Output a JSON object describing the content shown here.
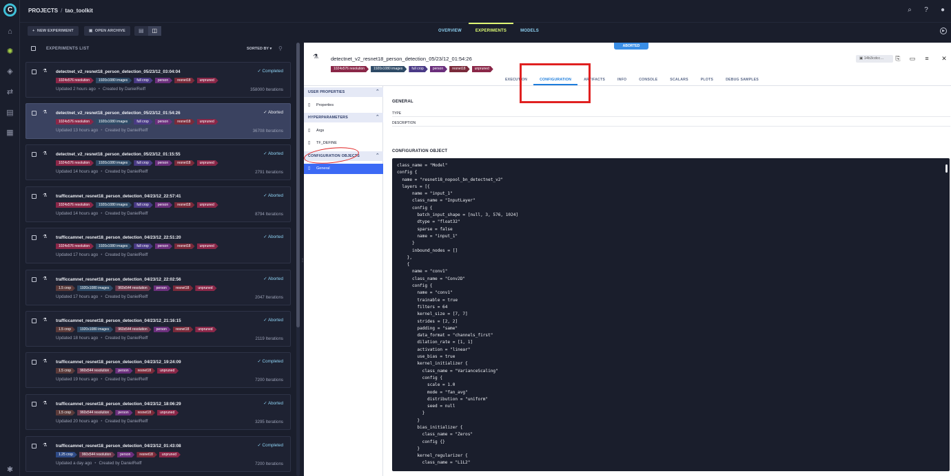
{
  "breadcrumb": {
    "projects": "PROJECTS",
    "separator": "/",
    "project": "tao_toolkit"
  },
  "toolbar": {
    "new_experiment": "NEW EXPERIMENT",
    "open_archive": "OPEN ARCHIVE"
  },
  "main_tabs": [
    {
      "label": "OVERVIEW"
    },
    {
      "label": "EXPERIMENTS"
    },
    {
      "label": "MODELS"
    }
  ],
  "list": {
    "title": "EXPERIMENTS LIST",
    "sorted_by": "SORTED BY ▾",
    "items": [
      {
        "name": "detectnet_v2_resnet18_person_detection_05/23/12_03:04:04",
        "status": "✓ Completed",
        "tags": [
          "1024x576 resolution",
          "1920x1080 images",
          "full crop",
          "person",
          "resnet18",
          "unpruned"
        ],
        "updated": "Updated 2 hours ago",
        "creator": "Created by DanielReiff",
        "iterations": "358000 Iterations"
      },
      {
        "name": "detectnet_v2_resnet18_person_detection_05/23/12_01:54:26",
        "status": "✓ Aborted",
        "tags": [
          "1024x576 resolution",
          "1920x1080 images",
          "full crop",
          "person",
          "resnet18",
          "unpruned"
        ],
        "updated": "Updated 13 hours ago",
        "creator": "Created by DanielReiff",
        "iterations": "36708 Iterations"
      },
      {
        "name": "detectnet_v2_resnet18_person_detection_05/23/12_01:15:55",
        "status": "✓ Aborted",
        "tags": [
          "1024x576 resolution",
          "1920x1080 images",
          "full crop",
          "person",
          "resnet18",
          "unpruned"
        ],
        "updated": "Updated 14 hours ago",
        "creator": "Created by DanielReiff",
        "iterations": "2791 Iterations"
      },
      {
        "name": "trafficcamnet_resnet18_person_detection_04/23/12_22:57:41",
        "status": "✓ Aborted",
        "tags": [
          "1024x576 resolution",
          "1920x1080 images",
          "full crop",
          "person",
          "resnet18",
          "unpruned"
        ],
        "updated": "Updated 14 hours ago",
        "creator": "Created by DanielReiff",
        "iterations": "8794 Iterations"
      },
      {
        "name": "trafficcamnet_resnet18_person_detection_04/23/12_22:51:20",
        "status": "✓ Aborted",
        "tags": [
          "1024x576 resolution",
          "1920x1080 images",
          "full crop",
          "person",
          "resnet18",
          "unpruned"
        ],
        "updated": "Updated 17 hours ago",
        "creator": "Created by DanielReiff",
        "iterations": ""
      },
      {
        "name": "trafficcamnet_resnet18_person_detection_04/23/12_22:02:56",
        "status": "✓ Aborted",
        "tags": [
          "1.5 crop",
          "1920x1080 images",
          "960x544 resolution",
          "person",
          "resnet18",
          "unpruned"
        ],
        "updated": "Updated 17 hours ago",
        "creator": "Created by DanielReiff",
        "iterations": "2047 Iterations"
      },
      {
        "name": "trafficcamnet_resnet18_person_detection_04/23/12_21:16:15",
        "status": "✓ Aborted",
        "tags": [
          "1.5 crop",
          "1920x1080 images",
          "960x544 resolution",
          "person",
          "resnet18",
          "unpruned"
        ],
        "updated": "Updated 18 hours ago",
        "creator": "Created by DanielReiff",
        "iterations": "2119 Iterations"
      },
      {
        "name": "trafficcamnet_resnet18_person_detection_04/23/12_19:24:09",
        "status": "✓ Completed",
        "tags": [
          "1.5 crop",
          "960x544 resolution",
          "person",
          "resnet18",
          "unpruned"
        ],
        "updated": "Updated 19 hours ago",
        "creator": "Created by DanielReiff",
        "iterations": "7200 Iterations"
      },
      {
        "name": "trafficcamnet_resnet18_person_detection_04/23/12_18:06:29",
        "status": "✓ Aborted",
        "tags": [
          "1.5 crop",
          "960x544 resolution",
          "person",
          "resnet18",
          "unpruned"
        ],
        "updated": "Updated 20 hours ago",
        "creator": "Created by DanielReiff",
        "iterations": "3295 Iterations"
      },
      {
        "name": "trafficcamnet_resnet18_person_detection_04/23/12_01:43:08",
        "status": "✓ Completed",
        "tags": [
          "1.25 crop",
          "960x544 resolution",
          "person",
          "resnet18",
          "unpruned"
        ],
        "updated": "Updated a day ago",
        "creator": "Created by DanielReiff",
        "iterations": "7200 Iterations"
      }
    ]
  },
  "detail": {
    "ribbon": "ABORTED",
    "title": "detectnet_v2_resnet18_person_detection_05/23/12_01:54:26",
    "tags": [
      "1024x576 resolution",
      "1920x1080 images",
      "full crop",
      "person",
      "resnet18",
      "unpruned"
    ],
    "id": "14b3cdcc…",
    "tabs": [
      {
        "label": "EXECUTION"
      },
      {
        "label": "CONFIGURATION"
      },
      {
        "label": "ARTIFACTS"
      },
      {
        "label": "INFO"
      },
      {
        "label": "CONSOLE"
      },
      {
        "label": "SCALARS"
      },
      {
        "label": "PLOTS"
      },
      {
        "label": "DEBUG SAMPLES"
      }
    ],
    "nav": {
      "user_properties": "USER PROPERTIES",
      "properties": "Properties",
      "hyperparameters": "HYPERPARAMETERS",
      "args": "Args",
      "tf_define": "TF_DEFINE",
      "config_objects": "CONFIGURATION OBJECTS",
      "general": "General"
    },
    "general_title": "GENERAL",
    "type_label": "TYPE",
    "description_label": "DESCRIPTION",
    "config_object_title": "CONFIGURATION OBJECT",
    "code": "class_name = \"Model\"\nconfig {\n  name = \"resnet18_nopool_bn_detectnet_v2\"\n  layers = [{\n      name = \"input_1\"\n      class_name = \"InputLayer\"\n      config {\n        batch_input_shape = [null, 3, 576, 1024]\n        dtype = \"float32\"\n        sparse = false\n        name = \"input_1\"\n      }\n      inbound_nodes = []\n    },\n    {\n      name = \"conv1\"\n      class_name = \"Conv2D\"\n      config {\n        name = \"conv1\"\n        trainable = true\n        filters = 64\n        kernel_size = [7, 7]\n        strides = [2, 2]\n        padding = \"same\"\n        data_format = \"channels_first\"\n        dilation_rate = [1, 1]\n        activation = \"linear\"\n        use_bias = true\n        kernel_initializer {\n          class_name = \"VarianceScaling\"\n          config {\n            scale = 1.0\n            mode = \"fan_avg\"\n            distribution = \"uniform\"\n            seed = null\n          }\n        }\n        bias_initializer {\n          class_name = \"Zeros\"\n          config {}\n        }\n        kernel_regularizer {\n          class_name = \"L1L2\""
  },
  "colors": {
    "accent": "#e0ff74",
    "link": "#8ed3f4",
    "selected_nav": "#3c6af5",
    "annotation": "#e02020"
  }
}
